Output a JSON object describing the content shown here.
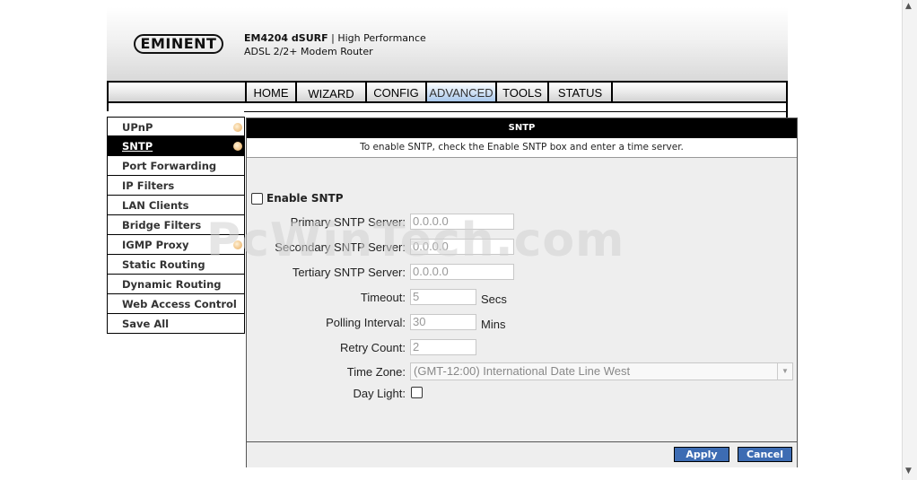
{
  "header": {
    "logo": "EMINENT",
    "model": "EM4204 dSURF",
    "separator": "|",
    "tagline": "High Performance",
    "subline": "ADSL 2/2+ Modem Router"
  },
  "nav": {
    "tabs": [
      {
        "label": "HOME"
      },
      {
        "label": "WIZARD"
      },
      {
        "label": "CONFIG"
      },
      {
        "label": "ADVANCED"
      },
      {
        "label": "TOOLS"
      },
      {
        "label": "STATUS"
      }
    ],
    "active": "ADVANCED"
  },
  "sidebar": {
    "items": [
      {
        "label": "UPnP",
        "has_dot": true
      },
      {
        "label": "SNTP",
        "has_dot": true
      },
      {
        "label": "Port Forwarding",
        "has_dot": false
      },
      {
        "label": "IP Filters",
        "has_dot": false
      },
      {
        "label": "LAN Clients",
        "has_dot": false
      },
      {
        "label": "Bridge Filters",
        "has_dot": false
      },
      {
        "label": "IGMP Proxy",
        "has_dot": true
      },
      {
        "label": "Static Routing",
        "has_dot": false
      },
      {
        "label": "Dynamic Routing",
        "has_dot": false
      },
      {
        "label": "Web Access Control",
        "has_dot": false
      },
      {
        "label": "Save All",
        "has_dot": false
      }
    ],
    "active": "SNTP"
  },
  "panel": {
    "title": "SNTP",
    "description": "To enable SNTP, check the Enable SNTP box and enter a time server.",
    "enable_label": "Enable SNTP",
    "enable_checked": false,
    "fields": {
      "primary": {
        "label": "Primary SNTP Server:",
        "value": "0.0.0.0"
      },
      "secondary": {
        "label": "Secondary SNTP Server:",
        "value": "0.0.0.0"
      },
      "tertiary": {
        "label": "Tertiary SNTP Server:",
        "value": "0.0.0.0"
      },
      "timeout": {
        "label": "Timeout:",
        "value": "5",
        "unit": "Secs"
      },
      "polling": {
        "label": "Polling Interval:",
        "value": "30",
        "unit": "Mins"
      },
      "retry": {
        "label": "Retry Count:",
        "value": "2"
      },
      "timezone": {
        "label": "Time Zone:",
        "value": "(GMT-12:00) International Date Line West"
      },
      "daylight": {
        "label": "Day Light:",
        "checked": false
      }
    },
    "buttons": {
      "apply": "Apply",
      "cancel": "Cancel"
    }
  },
  "watermark": "PcWinTech.com",
  "colors": {
    "nav_active": "#a9c8ec",
    "button": "#3d6cb3",
    "sidebar_active": "#000000",
    "dot": "#e8a855"
  }
}
